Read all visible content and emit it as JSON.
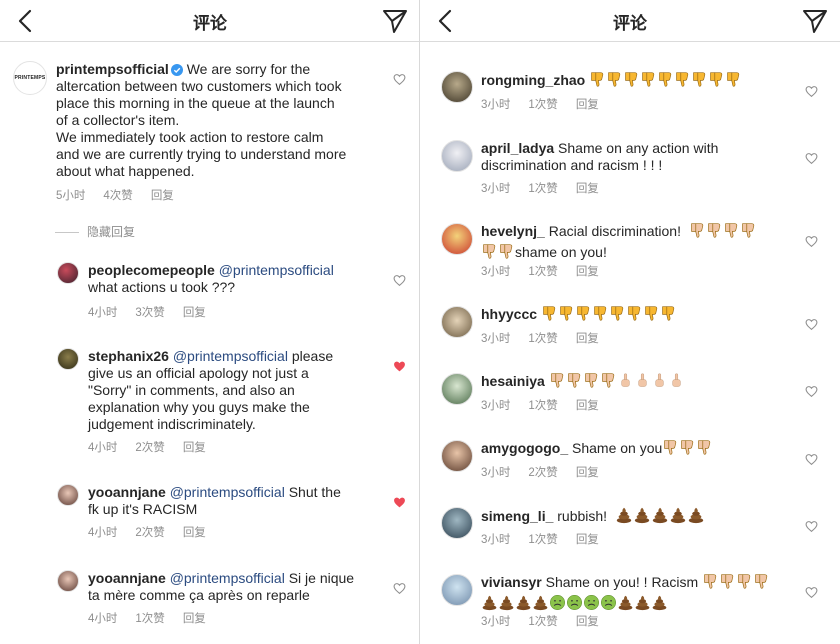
{
  "left": {
    "title": "评论",
    "comments": [
      {
        "username": "printempsofficial",
        "avatar_text": "PRINTEMPS",
        "lines": [
          "We are sorry for the",
          "altercation between two customers which took",
          "place this morning in the queue at the launch",
          "of a collector's item.",
          "We immediately took action to restore calm",
          "and we are currently trying to understand more",
          "about what happened."
        ],
        "time": "5小时",
        "likes": "4次赞",
        "reply": "回复"
      },
      {
        "username": "peoplecomepeople",
        "mention": "@printempsofficial",
        "lines": [
          "what actions u took ???"
        ],
        "time": "4小时",
        "likes": "3次赞",
        "reply": "回复"
      },
      {
        "username": "stephanix26",
        "mention": "@printempsofficial",
        "first_line_text": "please",
        "lines": [
          "give us an official apology not just a",
          "\"Sorry\" in comments, and also an",
          "explanation why you guys make the",
          "judgement indiscriminately."
        ],
        "time": "4小时",
        "likes": "2次赞",
        "reply": "回复"
      },
      {
        "username": "yooannjane",
        "mention": "@printempsofficial",
        "first_line_text": "Shut the",
        "lines": [
          "fk up it's RACISM"
        ],
        "time": "4小时",
        "likes": "2次赞",
        "reply": "回复"
      },
      {
        "username": "yooannjane",
        "mention": "@printempsofficial",
        "first_line_text": "Si je nique",
        "lines": [
          "ta mère comme ça après on reparle"
        ],
        "time": "4小时",
        "likes": "1次赞",
        "reply": "回复"
      }
    ],
    "hidden_replies": "隐藏回复"
  },
  "right": {
    "title": "评论",
    "comments": [
      {
        "username": "rongming_zhao",
        "text": "",
        "time": "3小时",
        "likes": "1次赞",
        "reply": "回复"
      },
      {
        "username": "april_ladya",
        "text": "Shame on any action with",
        "line2": "discrimination and racism ! ! !",
        "time": "3小时",
        "likes": "1次赞",
        "reply": "回复"
      },
      {
        "username": "hevelynj_",
        "text": "Racial discrimination!",
        "line2": "shame on you!",
        "time": "3小时",
        "likes": "1次赞",
        "reply": "回复"
      },
      {
        "username": "hhyyccc",
        "text": "",
        "time": "3小时",
        "likes": "1次赞",
        "reply": "回复"
      },
      {
        "username": "hesainiya",
        "text": "",
        "time": "3小时",
        "likes": "1次赞",
        "reply": "回复"
      },
      {
        "username": "amygogogo_",
        "text": "Shame on you",
        "time": "3小时",
        "likes": "2次赞",
        "reply": "回复"
      },
      {
        "username": "simeng_li_",
        "text": "rubbish!",
        "time": "3小时",
        "likes": "1次赞",
        "reply": "回复"
      },
      {
        "username": "viviansyr",
        "text": "Shame on you! ! Racism",
        "time": "3小时",
        "likes": "1次赞",
        "reply": "回复"
      }
    ]
  },
  "icons": {
    "back": "chevron-left-icon",
    "send": "paper-plane-icon",
    "heart": "heart-icon",
    "verified": "verified-badge-icon",
    "thumbs_down": "thumbs-down-emoji",
    "poop": "poop-emoji",
    "index_finger_up": "index-pointing-up-emoji",
    "nauseated": "nauseated-face-emoji"
  },
  "colors": {
    "liked_heart": "#ed4956",
    "mention": "#2b4b80",
    "meta": "#8e8e8e",
    "thumb_yellow": "#f7b731",
    "thumb_skin": "#f1c6a7"
  }
}
